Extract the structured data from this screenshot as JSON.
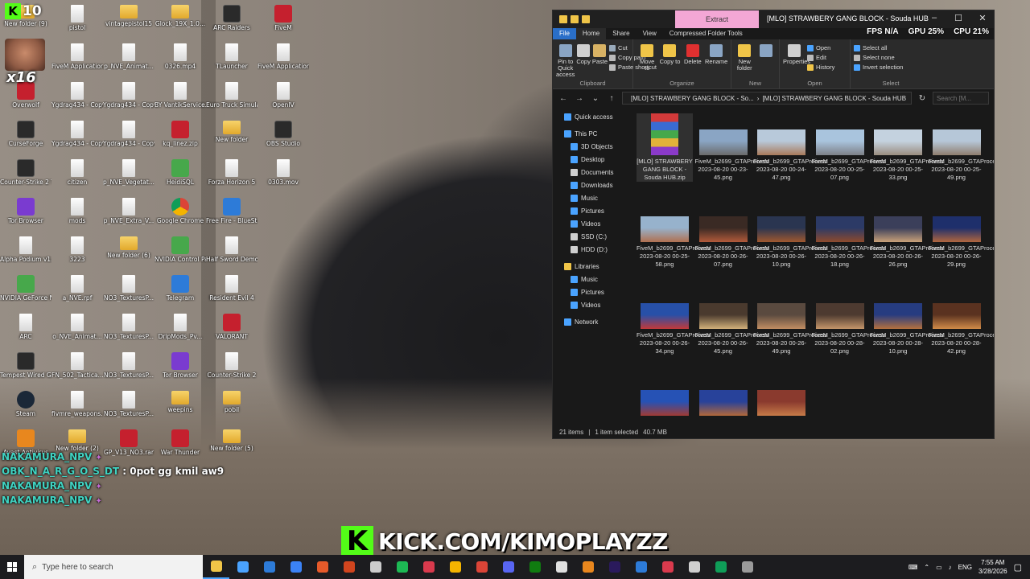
{
  "overlay": {
    "kick_badge_num": "10",
    "sub_badge": "x16",
    "kick_url": "KICK.COM/KIMOPLAYZZ",
    "kick_k": "K"
  },
  "chat": [
    {
      "user": "NAKAMURA_NPV",
      "star": "✦",
      "msg": ""
    },
    {
      "user": "OBK_N_A_R_G_O_S_DT",
      "star": "",
      "msg": ": 0pot gg kmil aw9"
    },
    {
      "user": "NAKAMURA_NPV",
      "star": "✦",
      "msg": ""
    },
    {
      "user": "NAKAMURA_NPV",
      "star": "✦",
      "msg": ""
    }
  ],
  "desktop_icons": [
    {
      "label": "New folder (9)",
      "type": "folder",
      "col": 0,
      "row": 0
    },
    {
      "label": "Overwolf",
      "type": "red",
      "col": 0,
      "row": 2
    },
    {
      "label": "CurseForge",
      "type": "dark",
      "col": 0,
      "row": 3
    },
    {
      "label": "Counter-Strike 2 Tracker",
      "type": "dark",
      "col": 0,
      "row": 4
    },
    {
      "label": "Tor Browser",
      "type": "purple",
      "col": 0,
      "row": 5
    },
    {
      "label": "Alpha Podium v1.7.2",
      "type": "file",
      "col": 0,
      "row": 6
    },
    {
      "label": "NVIDIA GeForce NOW",
      "type": "green",
      "col": 0,
      "row": 7
    },
    {
      "label": "ARC",
      "type": "file",
      "col": 0,
      "row": 8
    },
    {
      "label": "Tempest Wired Gaming Mouse",
      "type": "dark",
      "col": 0,
      "row": 9
    },
    {
      "label": "Steam",
      "type": "steam",
      "col": 0,
      "row": 10
    },
    {
      "label": "Avast Antivirus",
      "type": "orange",
      "col": 0,
      "row": 11
    },
    {
      "label": "pistol",
      "type": "file",
      "col": 1,
      "row": 0
    },
    {
      "label": "FiveM Application Data",
      "type": "file",
      "col": 1,
      "row": 1
    },
    {
      "label": "Ygdrag434 - Copy (2).rpf",
      "type": "file",
      "col": 1,
      "row": 2
    },
    {
      "label": "Ygdrag434 - Copy (3).rpf",
      "type": "file",
      "col": 1,
      "row": 3
    },
    {
      "label": "citizen",
      "type": "file",
      "col": 1,
      "row": 4
    },
    {
      "label": "mods",
      "type": "file",
      "col": 1,
      "row": 5
    },
    {
      "label": "3223",
      "type": "file",
      "col": 1,
      "row": 6
    },
    {
      "label": "a_NVE.rpf",
      "type": "file",
      "col": 1,
      "row": 7
    },
    {
      "label": "o_NVE_Animat...",
      "type": "file",
      "col": 1,
      "row": 8
    },
    {
      "label": "FN_502_Tactica...",
      "type": "file",
      "col": 1,
      "row": 9
    },
    {
      "label": "fivmre_weapons...",
      "type": "file",
      "col": 1,
      "row": 10
    },
    {
      "label": "New folder (2)",
      "type": "folder",
      "col": 1,
      "row": 11
    },
    {
      "label": "vintagepistol15",
      "type": "folder",
      "col": 2,
      "row": 0
    },
    {
      "label": "p_NVE_Animat...",
      "type": "file",
      "col": 2,
      "row": 1
    },
    {
      "label": "Ygdrag434 - Copy - Co...",
      "type": "file",
      "col": 2,
      "row": 2
    },
    {
      "label": "Ygdrag434 - Copy - Co...",
      "type": "file",
      "col": 2,
      "row": 3
    },
    {
      "label": "p_NVE_Vegetat...",
      "type": "file",
      "col": 2,
      "row": 4
    },
    {
      "label": "p_NVE_Extra_V...",
      "type": "file",
      "col": 2,
      "row": 5
    },
    {
      "label": "New folder (6)",
      "type": "folder",
      "col": 2,
      "row": 6
    },
    {
      "label": "NO3_TexturesP...",
      "type": "file",
      "col": 2,
      "row": 7
    },
    {
      "label": "NO3_TexturesP...",
      "type": "file",
      "col": 2,
      "row": 8
    },
    {
      "label": "NO3_TexturesP...",
      "type": "file",
      "col": 2,
      "row": 9
    },
    {
      "label": "NO3_TexturesP...",
      "type": "file",
      "col": 2,
      "row": 10
    },
    {
      "label": "GP_V13_NO3.rar",
      "type": "red",
      "col": 2,
      "row": 11
    },
    {
      "label": "Glock_19X_1.0...",
      "type": "folder",
      "col": 3,
      "row": 0
    },
    {
      "label": "0326.mp4",
      "type": "file",
      "col": 3,
      "row": 1
    },
    {
      "label": "BY VantikService.bat",
      "type": "file",
      "col": 3,
      "row": 2
    },
    {
      "label": "kq_linez.zip",
      "type": "red",
      "col": 3,
      "row": 3
    },
    {
      "label": "HeidiSQL",
      "type": "green",
      "col": 3,
      "row": 4
    },
    {
      "label": "Google Chrome",
      "type": "chrome",
      "col": 3,
      "row": 5
    },
    {
      "label": "NVIDIA Control Panel",
      "type": "green",
      "col": 3,
      "row": 6
    },
    {
      "label": "Telegram",
      "type": "blue",
      "col": 3,
      "row": 7
    },
    {
      "label": "DripMods_Pv...",
      "type": "file",
      "col": 3,
      "row": 8
    },
    {
      "label": "Tor Browser",
      "type": "purple",
      "col": 3,
      "row": 9
    },
    {
      "label": "weepins",
      "type": "folder",
      "col": 3,
      "row": 10
    },
    {
      "label": "War Thunder",
      "type": "red",
      "col": 3,
      "row": 11
    },
    {
      "label": "ARC Raiders",
      "type": "dark",
      "col": 4,
      "row": 0
    },
    {
      "label": "TLauncher",
      "type": "file",
      "col": 4,
      "row": 1
    },
    {
      "label": "Euro Truck Simulator 2",
      "type": "file",
      "col": 4,
      "row": 2
    },
    {
      "label": "New folder",
      "type": "folder",
      "col": 4,
      "row": 3
    },
    {
      "label": "Forza Horizon 5",
      "type": "file",
      "col": 4,
      "row": 4
    },
    {
      "label": "Free Fire - BlueStacks A...",
      "type": "blue",
      "col": 4,
      "row": 5
    },
    {
      "label": "Half Sword Demo",
      "type": "file",
      "col": 4,
      "row": 6
    },
    {
      "label": "Resident Evil 4",
      "type": "file",
      "col": 4,
      "row": 7
    },
    {
      "label": "VALORANT",
      "type": "red",
      "col": 4,
      "row": 8
    },
    {
      "label": "Counter-Strike 2",
      "type": "file",
      "col": 4,
      "row": 9
    },
    {
      "label": "pobil",
      "type": "folder",
      "col": 4,
      "row": 10
    },
    {
      "label": "New folder (5)",
      "type": "folder",
      "col": 4,
      "row": 11
    },
    {
      "label": "FiveM",
      "type": "red",
      "col": 5,
      "row": 0
    },
    {
      "label": "FiveM Application Da...",
      "type": "file",
      "col": 5,
      "row": 1
    },
    {
      "label": "OpenIV",
      "type": "file",
      "col": 5,
      "row": 2
    },
    {
      "label": "OBS Studio",
      "type": "dark",
      "col": 5,
      "row": 3
    },
    {
      "label": "0303.mov",
      "type": "file",
      "col": 5,
      "row": 4
    }
  ],
  "explorer": {
    "title": "[MLO] STRAWBERY GANG BLOCK - Souda HUB",
    "extract_tab": "Extract",
    "compressed_tools": "Compressed Folder Tools",
    "menu_tabs": {
      "file": "File",
      "home": "Home",
      "share": "Share",
      "view": "View"
    },
    "fps_label": "FPS",
    "fps_value": "N/A",
    "gpu_label": "GPU",
    "gpu_value": "25%",
    "cpu_label": "CPU",
    "cpu_value": "21%",
    "ribbon": {
      "pin": "Pin to Quick access",
      "copy": "Copy",
      "paste": "Paste",
      "cut": "Cut",
      "copy_path": "Copy path",
      "paste_shortcut": "Paste shortcut",
      "clipboard": "Clipboard",
      "move_to": "Move to",
      "copy_to": "Copy to",
      "delete": "Delete",
      "rename": "Rename",
      "organize": "Organize",
      "new_folder": "New folder",
      "new": "New",
      "properties": "Properties",
      "open": "Open",
      "edit": "Edit",
      "history": "History",
      "open_group": "Open",
      "select_all": "Select all",
      "select_none": "Select none",
      "invert_selection": "Invert selection",
      "select_group": "Select"
    },
    "address_left": "[MLO] STRAWBERY GANG BLOCK - So...",
    "address_right": "[MLO] STRAWBERY GANG BLOCK - Souda HUB",
    "search_placeholder": "Search [M...",
    "nav": [
      {
        "label": "Quick access",
        "indent": 1,
        "color": "#4aa3ff"
      },
      {
        "label": "This PC",
        "indent": 1,
        "color": "#4aa3ff"
      },
      {
        "label": "3D Objects",
        "indent": 2,
        "color": "#4aa3ff"
      },
      {
        "label": "Desktop",
        "indent": 2,
        "color": "#4aa3ff"
      },
      {
        "label": "Documents",
        "indent": 2,
        "color": "#cfcfcf"
      },
      {
        "label": "Downloads",
        "indent": 2,
        "color": "#4aa3ff"
      },
      {
        "label": "Music",
        "indent": 2,
        "color": "#4aa3ff"
      },
      {
        "label": "Pictures",
        "indent": 2,
        "color": "#4aa3ff"
      },
      {
        "label": "Videos",
        "indent": 2,
        "color": "#4aa3ff"
      },
      {
        "label": "SSD (C:)",
        "indent": 2,
        "color": "#cfcfcf"
      },
      {
        "label": "HDD (D:)",
        "indent": 2,
        "color": "#cfcfcf"
      },
      {
        "label": "Libraries",
        "indent": 1,
        "color": "#f0c548"
      },
      {
        "label": "Music",
        "indent": 2,
        "color": "#4aa3ff"
      },
      {
        "label": "Pictures",
        "indent": 2,
        "color": "#4aa3ff"
      },
      {
        "label": "Videos",
        "indent": 2,
        "color": "#4aa3ff"
      },
      {
        "label": "Network",
        "indent": 1,
        "color": "#4aa3ff"
      }
    ],
    "files": [
      {
        "name": "[MLO] STRAWBERY GANG BLOCK - Souda HUB.zip",
        "kind": "zip",
        "selected": true
      },
      {
        "name": "FiveM_b2699_GTAProcess 2023-08-20 00-23-45.png",
        "kind": "img",
        "c1": "#8aa5c4",
        "c2": "#6b6b6b"
      },
      {
        "name": "FiveM_b2699_GTAProcess 2023-08-20 00-24-47.png",
        "kind": "img",
        "c1": "#b8c9da",
        "c2": "#a97a5a"
      },
      {
        "name": "FiveM_b2699_GTAProcess 2023-08-20 00-25-07.png",
        "kind": "img",
        "c1": "#a9c4dd",
        "c2": "#7d8087"
      },
      {
        "name": "FiveM_b2699_GTAProcess 2023-08-20 00-25-33.png",
        "kind": "img",
        "c1": "#c4d2df",
        "c2": "#9a8d7f"
      },
      {
        "name": "FiveM_b2699_GTAProcess 2023-08-20 00-25-49.png",
        "kind": "img",
        "c1": "#b6c7d8",
        "c2": "#8f7e6e"
      },
      {
        "name": "FiveM_b2699_GTAProcess 2023-08-20 00-25-58.png",
        "kind": "img",
        "c1": "#97b2cc",
        "c2": "#b07050"
      },
      {
        "name": "FiveM_b2699_GTAProcess 2023-08-20 00-26-07.png",
        "kind": "img",
        "c1": "#3a2a24",
        "c2": "#b25a3a"
      },
      {
        "name": "FiveM_b2699_GTAProcess 2023-08-20 00-26-10.png",
        "kind": "img",
        "c1": "#2a3550",
        "c2": "#a0582f"
      },
      {
        "name": "FiveM_b2699_GTAProcess 2023-08-20 00-26-18.png",
        "kind": "img",
        "c1": "#2c3a66",
        "c2": "#8e4a2c"
      },
      {
        "name": "FiveM_b2699_GTAProcess 2023-08-20 00-26-26.png",
        "kind": "img",
        "c1": "#3b3f5a",
        "c2": "#c9a178"
      },
      {
        "name": "FiveM_b2699_GTAProcess 2023-08-20 00-26-29.png",
        "kind": "img",
        "c1": "#1e2f6b",
        "c2": "#b0663e"
      },
      {
        "name": "FiveM_b2699_GTAProcess 2023-08-20 00-26-34.png",
        "kind": "img",
        "c1": "#2750a8",
        "c2": "#c23a3a"
      },
      {
        "name": "FiveM_b2699_GTAProcess 2023-08-20 00-26-45.png",
        "kind": "img",
        "c1": "#4a3a2e",
        "c2": "#d2b07a"
      },
      {
        "name": "FiveM_b2699_GTAProcess 2023-08-20 00-26-49.png",
        "kind": "img",
        "c1": "#5a4a3f",
        "c2": "#c08d62"
      },
      {
        "name": "FiveM_b2699_GTAProcess 2023-08-20 00-28-02.png",
        "kind": "img",
        "c1": "#4d3a30",
        "c2": "#c4956a"
      },
      {
        "name": "FiveM_b2699_GTAProcess 2023-08-20 00-28-10.png",
        "kind": "img",
        "c1": "#263c80",
        "c2": "#b5713e"
      },
      {
        "name": "FiveM_b2699_GTAProcess 2023-08-20 00-28-42.png",
        "kind": "img",
        "c1": "#5a3220",
        "c2": "#d08a48"
      },
      {
        "name": "",
        "kind": "img",
        "c1": "#2652b5",
        "c2": "#a13a34"
      },
      {
        "name": "",
        "kind": "img",
        "c1": "#28429a",
        "c2": "#b2683a"
      },
      {
        "name": "",
        "kind": "img",
        "c1": "#8a3a2e",
        "c2": "#c77b48"
      }
    ],
    "status_count": "21 items",
    "status_selected": "1 item selected",
    "status_size": "40.7 MB"
  },
  "taskbar": {
    "search_placeholder": "Type here to search",
    "apps": [
      {
        "name": "file-explorer-icon",
        "color": "#f0c548",
        "active": true
      },
      {
        "name": "app-icon-1",
        "color": "#4aa3ff"
      },
      {
        "name": "calendar-icon",
        "color": "#2d7bd8"
      },
      {
        "name": "app-icon-2",
        "color": "#3b82f6"
      },
      {
        "name": "edge-icon",
        "color": "#e65a2a"
      },
      {
        "name": "app-icon-3",
        "color": "#d1451e"
      },
      {
        "name": "openai-icon",
        "color": "#cccccc"
      },
      {
        "name": "spotify-icon",
        "color": "#1db954"
      },
      {
        "name": "adobe-icon",
        "color": "#d93a4d"
      },
      {
        "name": "chrome-icon",
        "color": "#f4b400"
      },
      {
        "name": "chrome-icon-2",
        "color": "#db4437"
      },
      {
        "name": "discord-icon",
        "color": "#5865f2"
      },
      {
        "name": "xbox-icon",
        "color": "#107c10"
      },
      {
        "name": "app-icon-4",
        "color": "#e0e0e0"
      },
      {
        "name": "app-icon-5",
        "color": "#e8871e"
      },
      {
        "name": "after-effects-icon",
        "color": "#2a1a5c"
      },
      {
        "name": "vscode-icon",
        "color": "#2d7bd8"
      },
      {
        "name": "fivem-icon",
        "color": "#d93a4d"
      },
      {
        "name": "settings-icon",
        "color": "#cfcfcf"
      },
      {
        "name": "chrome-icon-3",
        "color": "#0f9d58"
      },
      {
        "name": "app-icon-6",
        "color": "#9a9a9a"
      }
    ],
    "lang": "ENG",
    "time": "7:55 AM",
    "date": "3/28/2026"
  }
}
